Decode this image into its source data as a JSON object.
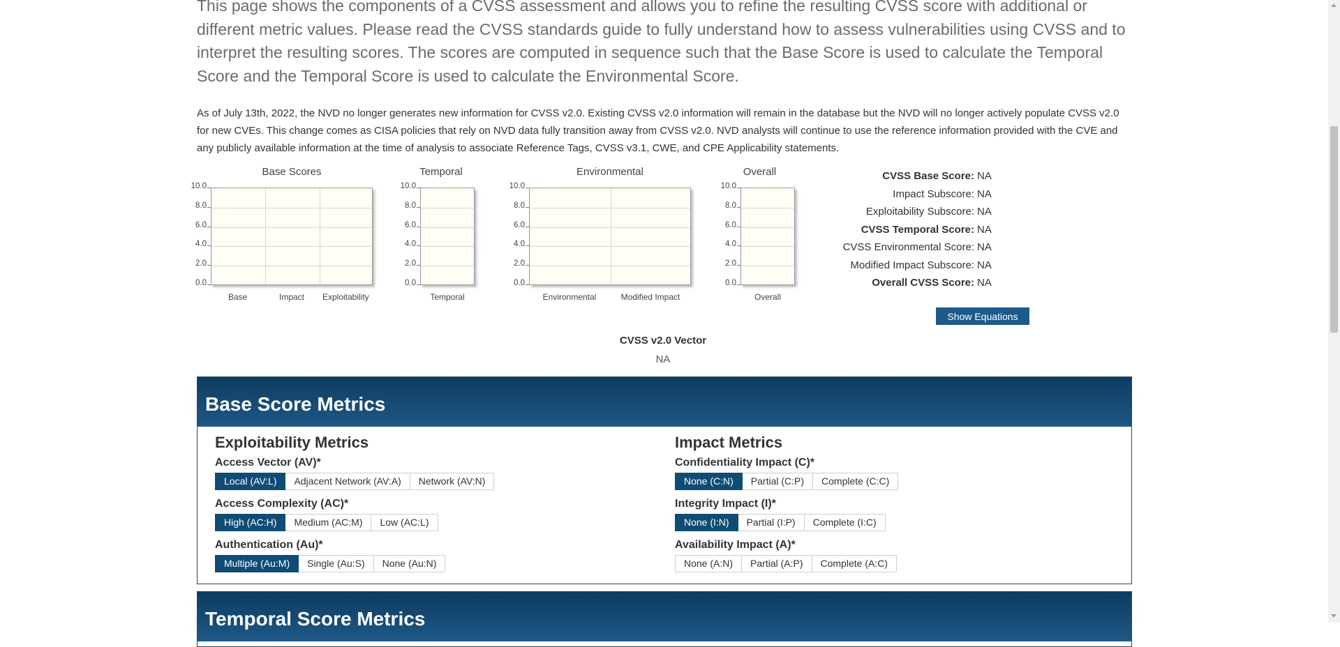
{
  "intro": "This page shows the components of a CVSS assessment and allows you to refine the resulting CVSS score with additional or different metric values. Please read the CVSS standards guide to fully understand how to assess vulnerabilities using CVSS and to interpret the resulting scores. The scores are computed in sequence such that the Base Score is used to calculate the Temporal Score and the Temporal Score is used to calculate the Environmental Score.",
  "notice": "As of July 13th, 2022, the NVD no longer generates new information for CVSS v2.0. Existing CVSS v2.0 information will remain in the database but the NVD will no longer actively populate CVSS v2.0 for new CVEs. This change comes as CISA policies that rely on NVD data fully transition away from CVSS v2.0. NVD analysts will continue to use the reference information provided with the CVE and any publicly available information at the time of analysis to associate Reference Tags, CVSS v3.1, CWE, and CPE Applicability statements.",
  "charts": {
    "base": {
      "title": "Base Scores",
      "categories": [
        "Base",
        "Impact",
        "Exploitability"
      ]
    },
    "temporal": {
      "title": "Temporal",
      "categories": [
        "Temporal"
      ]
    },
    "environmental": {
      "title": "Environmental",
      "categories": [
        "Environmental",
        "Modified Impact"
      ]
    },
    "overall": {
      "title": "Overall",
      "categories": [
        "Overall"
      ]
    },
    "yticks": [
      "10.0",
      "8.0",
      "6.0",
      "4.0",
      "2.0",
      "0.0"
    ]
  },
  "chart_data": [
    {
      "type": "bar",
      "title": "Base Scores",
      "categories": [
        "Base",
        "Impact",
        "Exploitability"
      ],
      "values": [
        null,
        null,
        null
      ],
      "ylim": [
        0,
        10
      ],
      "grid": true
    },
    {
      "type": "bar",
      "title": "Temporal",
      "categories": [
        "Temporal"
      ],
      "values": [
        null
      ],
      "ylim": [
        0,
        10
      ],
      "grid": true
    },
    {
      "type": "bar",
      "title": "Environmental",
      "categories": [
        "Environmental",
        "Modified Impact"
      ],
      "values": [
        null,
        null
      ],
      "ylim": [
        0,
        10
      ],
      "grid": true
    },
    {
      "type": "bar",
      "title": "Overall",
      "categories": [
        "Overall"
      ],
      "values": [
        null
      ],
      "ylim": [
        0,
        10
      ],
      "grid": true
    }
  ],
  "scores": [
    {
      "label": "CVSS Base Score:",
      "value": "NA",
      "bold": true
    },
    {
      "label": "Impact Subscore:",
      "value": "NA",
      "bold": false
    },
    {
      "label": "Exploitability Subscore:",
      "value": "NA",
      "bold": false
    },
    {
      "label": "CVSS Temporal Score:",
      "value": "NA",
      "bold": true
    },
    {
      "label": "CVSS Environmental Score:",
      "value": "NA",
      "bold": false
    },
    {
      "label": "Modified Impact Subscore:",
      "value": "NA",
      "bold": false
    },
    {
      "label": "Overall CVSS Score:",
      "value": "NA",
      "bold": true
    }
  ],
  "show_equations_label": "Show Equations",
  "vector": {
    "title": "CVSS v2.0 Vector",
    "value": "NA"
  },
  "base_panel": {
    "title": "Base Score Metrics",
    "exploitability": {
      "title": "Exploitability Metrics",
      "metrics": [
        {
          "title": "Access Vector (AV)*",
          "options": [
            {
              "label": "Local (AV:L)",
              "selected": true
            },
            {
              "label": "Adjacent Network (AV:A)",
              "selected": false
            },
            {
              "label": "Network (AV:N)",
              "selected": false
            }
          ]
        },
        {
          "title": "Access Complexity (AC)*",
          "options": [
            {
              "label": "High (AC:H)",
              "selected": true
            },
            {
              "label": "Medium (AC:M)",
              "selected": false
            },
            {
              "label": "Low (AC:L)",
              "selected": false
            }
          ]
        },
        {
          "title": "Authentication (Au)*",
          "options": [
            {
              "label": "Multiple (Au:M)",
              "selected": true
            },
            {
              "label": "Single (Au:S)",
              "selected": false
            },
            {
              "label": "None (Au:N)",
              "selected": false
            }
          ]
        }
      ]
    },
    "impact": {
      "title": "Impact Metrics",
      "metrics": [
        {
          "title": "Confidentiality Impact (C)*",
          "options": [
            {
              "label": "None (C:N)",
              "selected": true
            },
            {
              "label": "Partial (C:P)",
              "selected": false
            },
            {
              "label": "Complete (C:C)",
              "selected": false
            }
          ]
        },
        {
          "title": "Integrity Impact (I)*",
          "options": [
            {
              "label": "None (I:N)",
              "selected": true
            },
            {
              "label": "Partial (I:P)",
              "selected": false
            },
            {
              "label": "Complete (I:C)",
              "selected": false
            }
          ]
        },
        {
          "title": "Availability Impact (A)*",
          "options": [
            {
              "label": "None (A:N)",
              "selected": false
            },
            {
              "label": "Partial (A:P)",
              "selected": false
            },
            {
              "label": "Complete (A:C)",
              "selected": false
            }
          ]
        }
      ]
    }
  },
  "temporal_panel": {
    "title": "Temporal Score Metrics"
  }
}
